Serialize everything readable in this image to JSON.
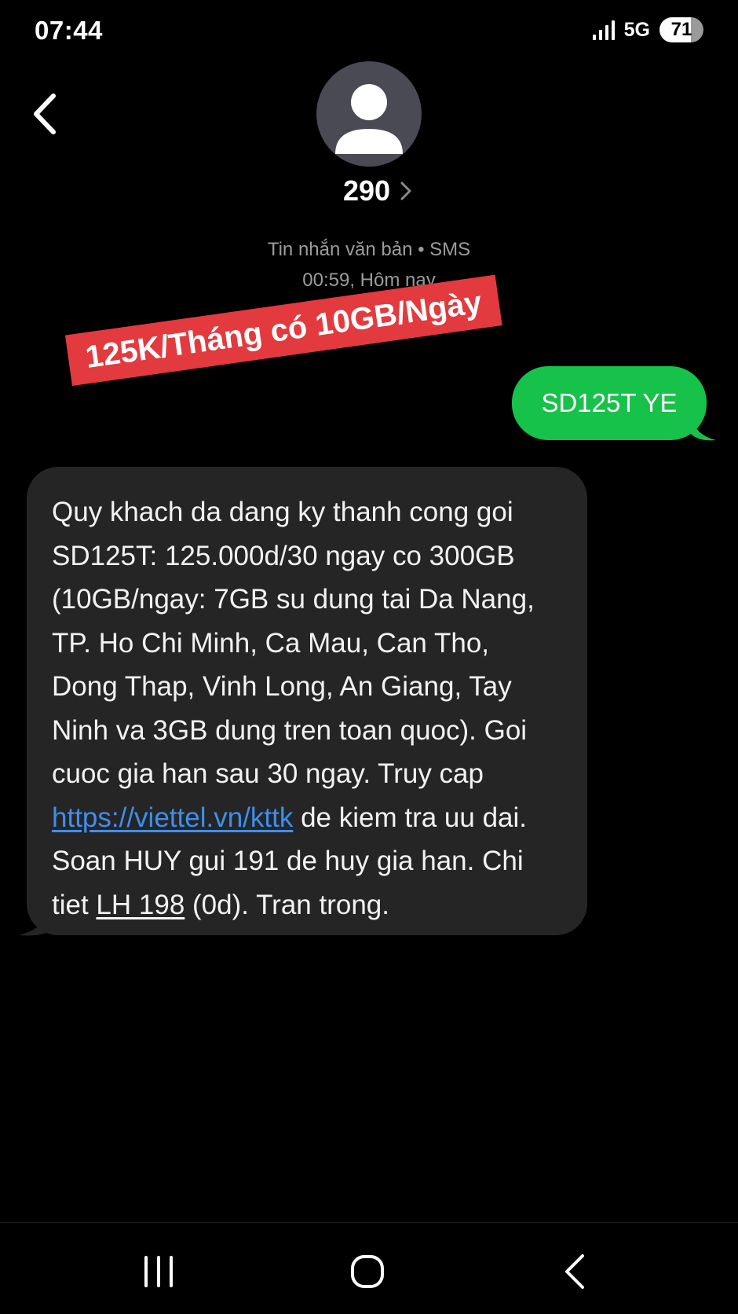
{
  "status_bar": {
    "time": "07:44",
    "network": "5G",
    "battery": "71"
  },
  "header": {
    "contact_name": "290",
    "message_type": "Tin nhắn văn bản • SMS",
    "timestamp": "00:59, Hôm nay"
  },
  "overlay": {
    "promo_text": "125K/Tháng có 10GB/Ngày"
  },
  "conversation": {
    "sent_message": "SD125T YE",
    "received": {
      "text_part1": "Quy khach da dang ky thanh cong goi SD125T: 125.000d/30 ngay co 300GB (10GB/ngay: 7GB su dung tai Da Nang, TP. Ho Chi Minh, Ca Mau, Can Tho, Dong Thap, Vinh Long, An Giang, Tay Ninh va 3GB dung tren toan quoc). Goi cuoc gia han sau 30 ngay. Truy cap ",
      "link": "https://viettel.vn/kttk",
      "text_part2": " de kiem tra uu dai. Soan HUY gui 191 de huy gia han. Chi tiet ",
      "phone": "LH 198",
      "text_part3": " (0d). Tran trong."
    }
  },
  "colors": {
    "sent_bubble": "#17c24a",
    "received_bubble": "#252525",
    "link": "#3d8ff0",
    "promo_banner": "#e23a3e"
  },
  "icons": {
    "back": "chevron-left-icon",
    "contact_details": "chevron-right-icon",
    "avatar": "person-icon",
    "nav_recents": "recents-icon",
    "nav_home": "home-icon",
    "nav_back": "back-icon"
  }
}
